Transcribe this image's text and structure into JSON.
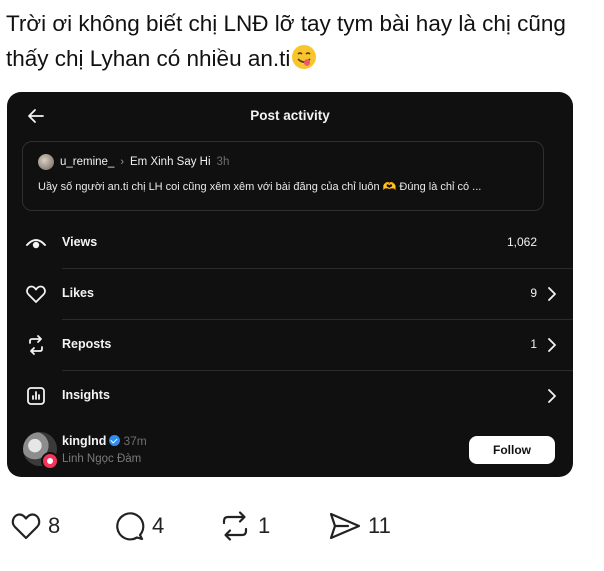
{
  "caption": {
    "text": "Trời ơi không biết chị LNĐ lỡ tay tym bài hay là chị cũng thấy chị Lyhan có nhiều an.ti",
    "emoji": "yum-face-emoji"
  },
  "card": {
    "title": "Post activity",
    "post": {
      "username": "u_remine_",
      "replying_to": "Em Xinh Say Hi",
      "time": "3h",
      "text_before": "Uầy số người an.ti chị LH coi cũng xêm xêm với bài đăng của chỉ luôn",
      "text_after": "Đúng là chỉ có ..."
    },
    "stats": [
      {
        "label": "Views",
        "value": "1,062",
        "icon": "eye-icon"
      },
      {
        "label": "Likes",
        "value": "9",
        "icon": "heart-icon"
      },
      {
        "label": "Reposts",
        "value": "1",
        "icon": "repost-icon"
      },
      {
        "label": "Insights",
        "value": "",
        "icon": "insights-icon"
      }
    ],
    "follower": {
      "username": "kinglnd",
      "time": "37m",
      "full_name": "Linh Ngọc Đàm",
      "follow_label": "Follow"
    }
  },
  "actions": {
    "likes": "8",
    "comments": "4",
    "reposts": "1",
    "shares": "11"
  },
  "colors": {
    "card_bg": "#101010",
    "verified": "#2f8cf0",
    "badge": "#f2345a"
  }
}
